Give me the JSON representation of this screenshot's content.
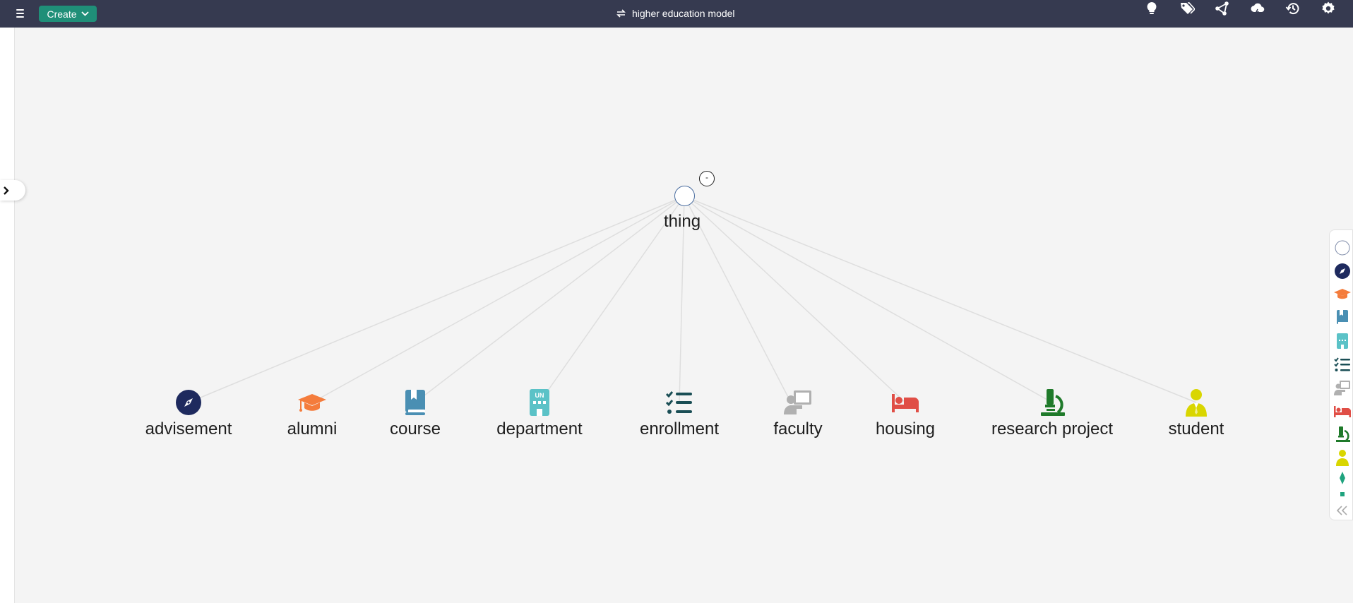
{
  "header": {
    "create_label": "Create",
    "title": "higher education model",
    "icons": [
      "lightbulb-icon",
      "tags-icon",
      "network-icon",
      "cloud-icon",
      "history-icon",
      "settings-icon"
    ]
  },
  "graph": {
    "root": {
      "label": "thing",
      "collapse_symbol": "-"
    },
    "nodes": [
      {
        "label": "advisement",
        "icon": "compass-icon",
        "color": "#1e2a5e"
      },
      {
        "label": "alumni",
        "icon": "graduation-cap-icon",
        "color": "#f47c3c"
      },
      {
        "label": "course",
        "icon": "book-icon",
        "color": "#4a8fb3"
      },
      {
        "label": "department",
        "icon": "un-building-icon",
        "color": "#5bc2c7"
      },
      {
        "label": "enrollment",
        "icon": "checklist-icon",
        "color": "#1a4e55"
      },
      {
        "label": "faculty",
        "icon": "teacher-icon",
        "color": "#b0b0b0"
      },
      {
        "label": "housing",
        "icon": "bed-icon",
        "color": "#e04e46"
      },
      {
        "label": "research project",
        "icon": "microscope-icon",
        "color": "#1f7a2a"
      },
      {
        "label": "student",
        "icon": "student-icon",
        "color": "#d9d600"
      }
    ]
  },
  "palette": {
    "items": [
      "circle-icon",
      "compass-icon",
      "graduation-cap-icon",
      "book-icon",
      "un-building-icon",
      "checklist-icon",
      "teacher-icon",
      "bed-icon",
      "microscope-icon",
      "student-icon",
      "diamond-icon",
      "square-icon",
      "collapse-icon"
    ]
  }
}
